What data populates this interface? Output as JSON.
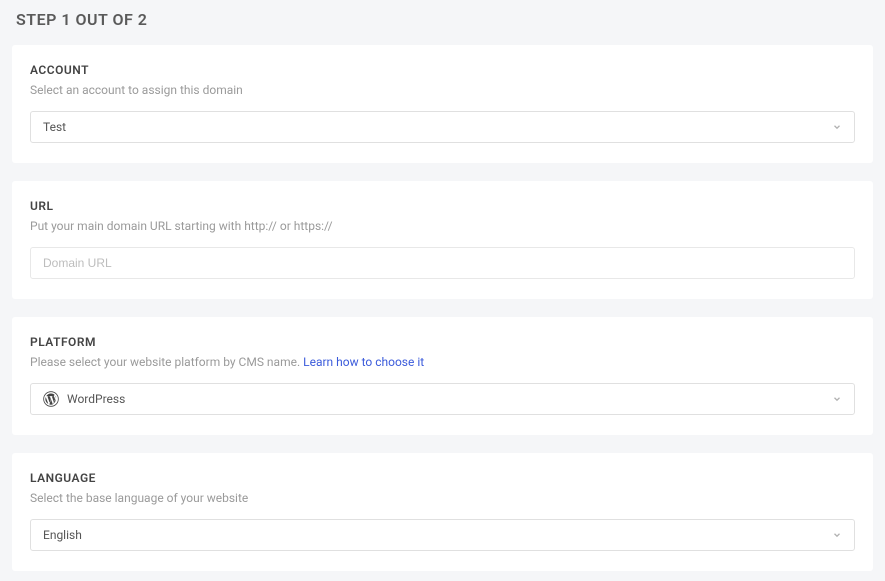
{
  "step": {
    "title": "STEP 1 OUT OF 2"
  },
  "account": {
    "title": "ACCOUNT",
    "subtitle": "Select an account to assign this domain",
    "value": "Test"
  },
  "url": {
    "title": "URL",
    "subtitle": "Put your main domain URL starting with http:// or https://",
    "placeholder": "Domain URL",
    "value": ""
  },
  "platform": {
    "title": "PLATFORM",
    "subtitle_prefix": "Please select your website platform by CMS name. ",
    "link_text": "Learn how to choose it",
    "value": "WordPress",
    "icon_name": "wordpress-icon"
  },
  "language": {
    "title": "LANGUAGE",
    "subtitle": "Select the base language of your website",
    "value": "English"
  }
}
